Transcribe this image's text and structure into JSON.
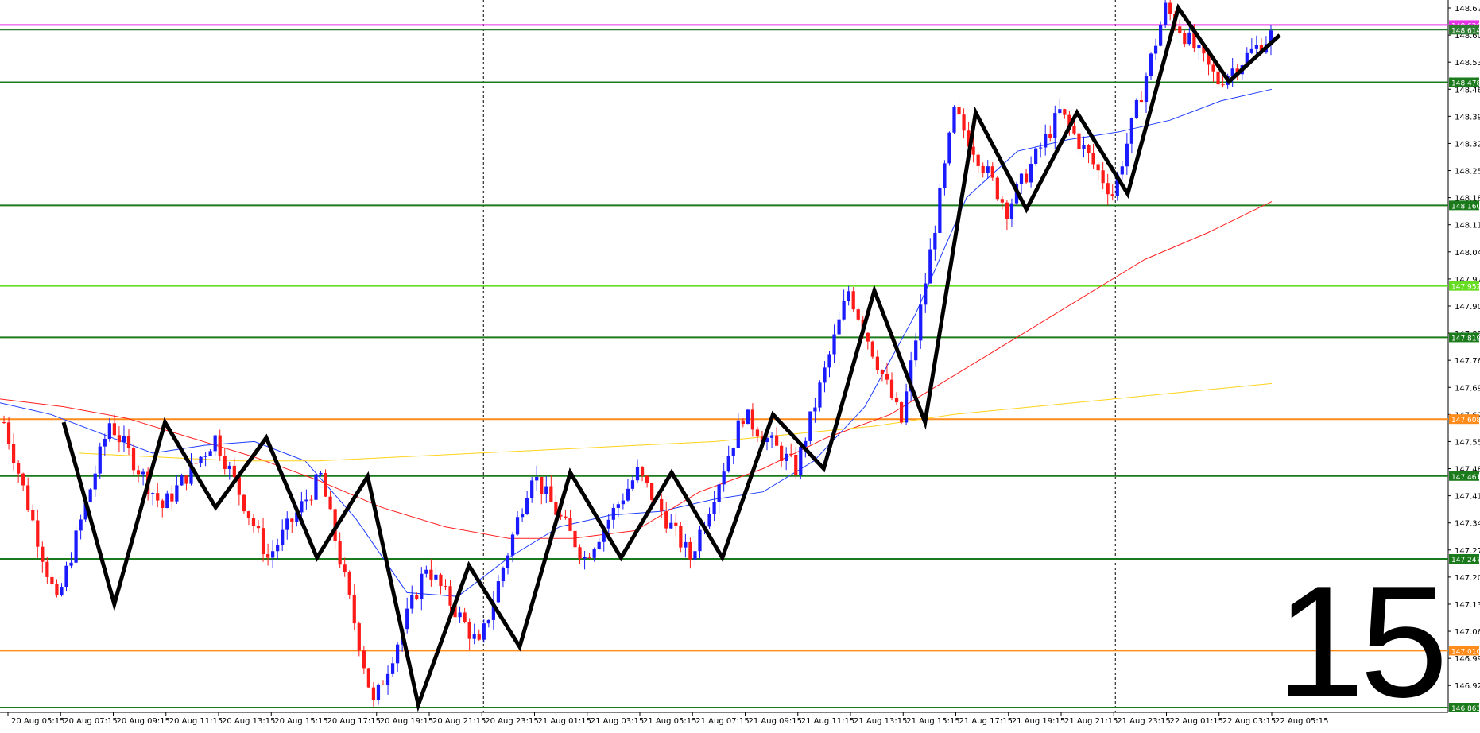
{
  "chart_data": {
    "type": "candlestick",
    "timeframe": "M15",
    "price_axis": {
      "min": 146.863,
      "max": 148.67,
      "ticks": [
        "148.670",
        "148.600",
        "148.530",
        "148.460",
        "148.390",
        "148.320",
        "148.250",
        "148.180",
        "148.110",
        "148.040",
        "147.970",
        "147.900",
        "147.830",
        "147.760",
        "147.690",
        "147.620",
        "147.550",
        "147.480",
        "147.410",
        "147.340",
        "147.270",
        "147.200",
        "147.130",
        "147.060",
        "146.990",
        "146.920"
      ]
    },
    "time_labels": [
      "20 Aug 05:15",
      "20 Aug 07:15",
      "20 Aug 09:15",
      "20 Aug 11:15",
      "20 Aug 13:15",
      "20 Aug 15:15",
      "20 Aug 17:15",
      "20 Aug 19:15",
      "20 Aug 21:15",
      "20 Aug 23:15",
      "21 Aug 01:15",
      "21 Aug 03:15",
      "21 Aug 05:15",
      "21 Aug 07:15",
      "21 Aug 09:15",
      "21 Aug 11:15",
      "21 Aug 13:15",
      "21 Aug 15:15",
      "21 Aug 17:15",
      "21 Aug 19:15",
      "21 Aug 21:15",
      "21 Aug 23:15",
      "22 Aug 01:15",
      "22 Aug 03:15",
      "22 Aug 05:15"
    ],
    "horizontal_levels": [
      {
        "price": 148.626,
        "label": "148.626",
        "color": "#e633e6"
      },
      {
        "price": 148.614,
        "label": "148.614",
        "color": "#2e7d32"
      },
      {
        "price": 148.478,
        "label": "148.478",
        "color": "#1b7a1b"
      },
      {
        "price": 148.16,
        "label": "148.160",
        "color": "#1b7a1b"
      },
      {
        "price": 147.952,
        "label": "147.952",
        "color": "#66dd22"
      },
      {
        "price": 147.819,
        "label": "147.819",
        "color": "#1b7a1b"
      },
      {
        "price": 147.608,
        "label": "147.608",
        "color": "#ff8c1a"
      },
      {
        "price": 147.461,
        "label": "147.461",
        "color": "#1b7a1b"
      },
      {
        "price": 147.247,
        "label": "147.247",
        "color": "#1b7a1b"
      },
      {
        "price": 147.01,
        "label": "147.010",
        "color": "#ff8c1a"
      },
      {
        "price": 146.863,
        "label": "146.863",
        "color": "#1b7a1b"
      }
    ],
    "current_price": {
      "price": 148.626,
      "label": "148.626",
      "color": "#e633e6"
    },
    "zigzag_prices": [
      147.6,
      147.13,
      147.6,
      147.38,
      147.56,
      147.25,
      147.46,
      146.87,
      147.23,
      147.02,
      147.47,
      147.25,
      147.47,
      147.25,
      147.62,
      147.48,
      147.94,
      147.6,
      148.4,
      148.15,
      148.4,
      148.19,
      148.67,
      148.48,
      148.6
    ],
    "ma_fast_label": "",
    "ma_series": [
      {
        "color": "#1e3cff",
        "values": [
          147.65,
          147.62,
          147.57,
          147.52,
          147.54,
          147.55,
          147.5,
          147.35,
          147.16,
          147.15,
          147.25,
          147.33,
          147.36,
          147.37,
          147.4,
          147.42,
          147.5,
          147.64,
          147.88,
          148.18,
          148.3,
          148.33,
          148.35,
          148.38,
          148.43,
          148.46
        ]
      },
      {
        "color": "#ff2020",
        "values": [
          147.66,
          147.64,
          147.61,
          147.56,
          147.51,
          147.45,
          147.38,
          147.33,
          147.3,
          147.3,
          147.32,
          147.42,
          147.48,
          147.56,
          147.62,
          147.72,
          147.82,
          147.92,
          148.02,
          148.09,
          148.17
        ]
      },
      {
        "color": "#ffd21a",
        "values": [
          147.52,
          147.51,
          147.5,
          147.5,
          147.51,
          147.52,
          147.53,
          147.54,
          147.55,
          147.57,
          147.59,
          147.62,
          147.64,
          147.66,
          147.68,
          147.7
        ]
      }
    ],
    "vertical_separators": [
      "20 Aug 23:15",
      "21 Aug 23:15"
    ],
    "big_number": "15"
  }
}
